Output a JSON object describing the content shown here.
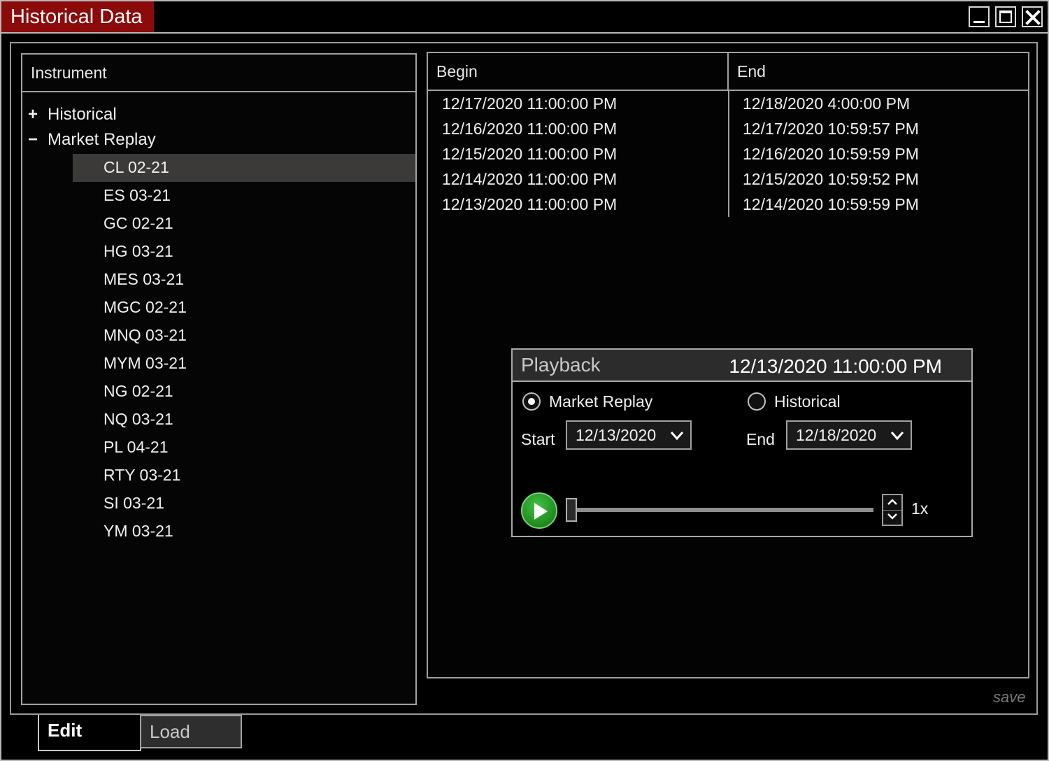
{
  "window": {
    "title": "Historical Data"
  },
  "instrument_panel": {
    "header": "Instrument",
    "nodes": [
      {
        "sign": "+",
        "label": "Historical"
      },
      {
        "sign": "−",
        "label": "Market Replay"
      }
    ],
    "items": [
      "CL 02-21",
      "ES 03-21",
      "GC 02-21",
      "HG 03-21",
      "MES 03-21",
      "MGC 02-21",
      "MNQ 03-21",
      "MYM 03-21",
      "NG 02-21",
      "NQ 03-21",
      "PL 04-21",
      "RTY 03-21",
      "SI 03-21",
      "YM 03-21"
    ],
    "selected": "CL 02-21"
  },
  "grid": {
    "columns": [
      "Begin",
      "End"
    ],
    "rows": [
      [
        "12/17/2020 11:00:00 PM",
        "12/18/2020 4:00:00 PM"
      ],
      [
        "12/16/2020 11:00:00 PM",
        "12/17/2020 10:59:57 PM"
      ],
      [
        "12/15/2020 11:00:00 PM",
        "12/16/2020 10:59:59 PM"
      ],
      [
        "12/14/2020 11:00:00 PM",
        "12/15/2020 10:59:52 PM"
      ],
      [
        "12/13/2020 11:00:00 PM",
        "12/14/2020 10:59:59 PM"
      ]
    ]
  },
  "playback": {
    "title": "Playback",
    "time": "12/13/2020 11:00:00 PM",
    "mode_market_replay": "Market Replay",
    "mode_historical": "Historical",
    "selected_mode": "Market Replay",
    "start_label": "Start",
    "start_date": "12/13/2020",
    "end_label": "End",
    "end_date": "12/18/2020",
    "speed": "1x",
    "progress": 0.0
  },
  "save_label": "save",
  "tabs": {
    "edit": "Edit",
    "load": "Load",
    "active": "Edit"
  },
  "colors": {
    "title_accent": "#8b0a0a",
    "play_green": "#2da02d",
    "selected_row": "#3b3a38"
  }
}
